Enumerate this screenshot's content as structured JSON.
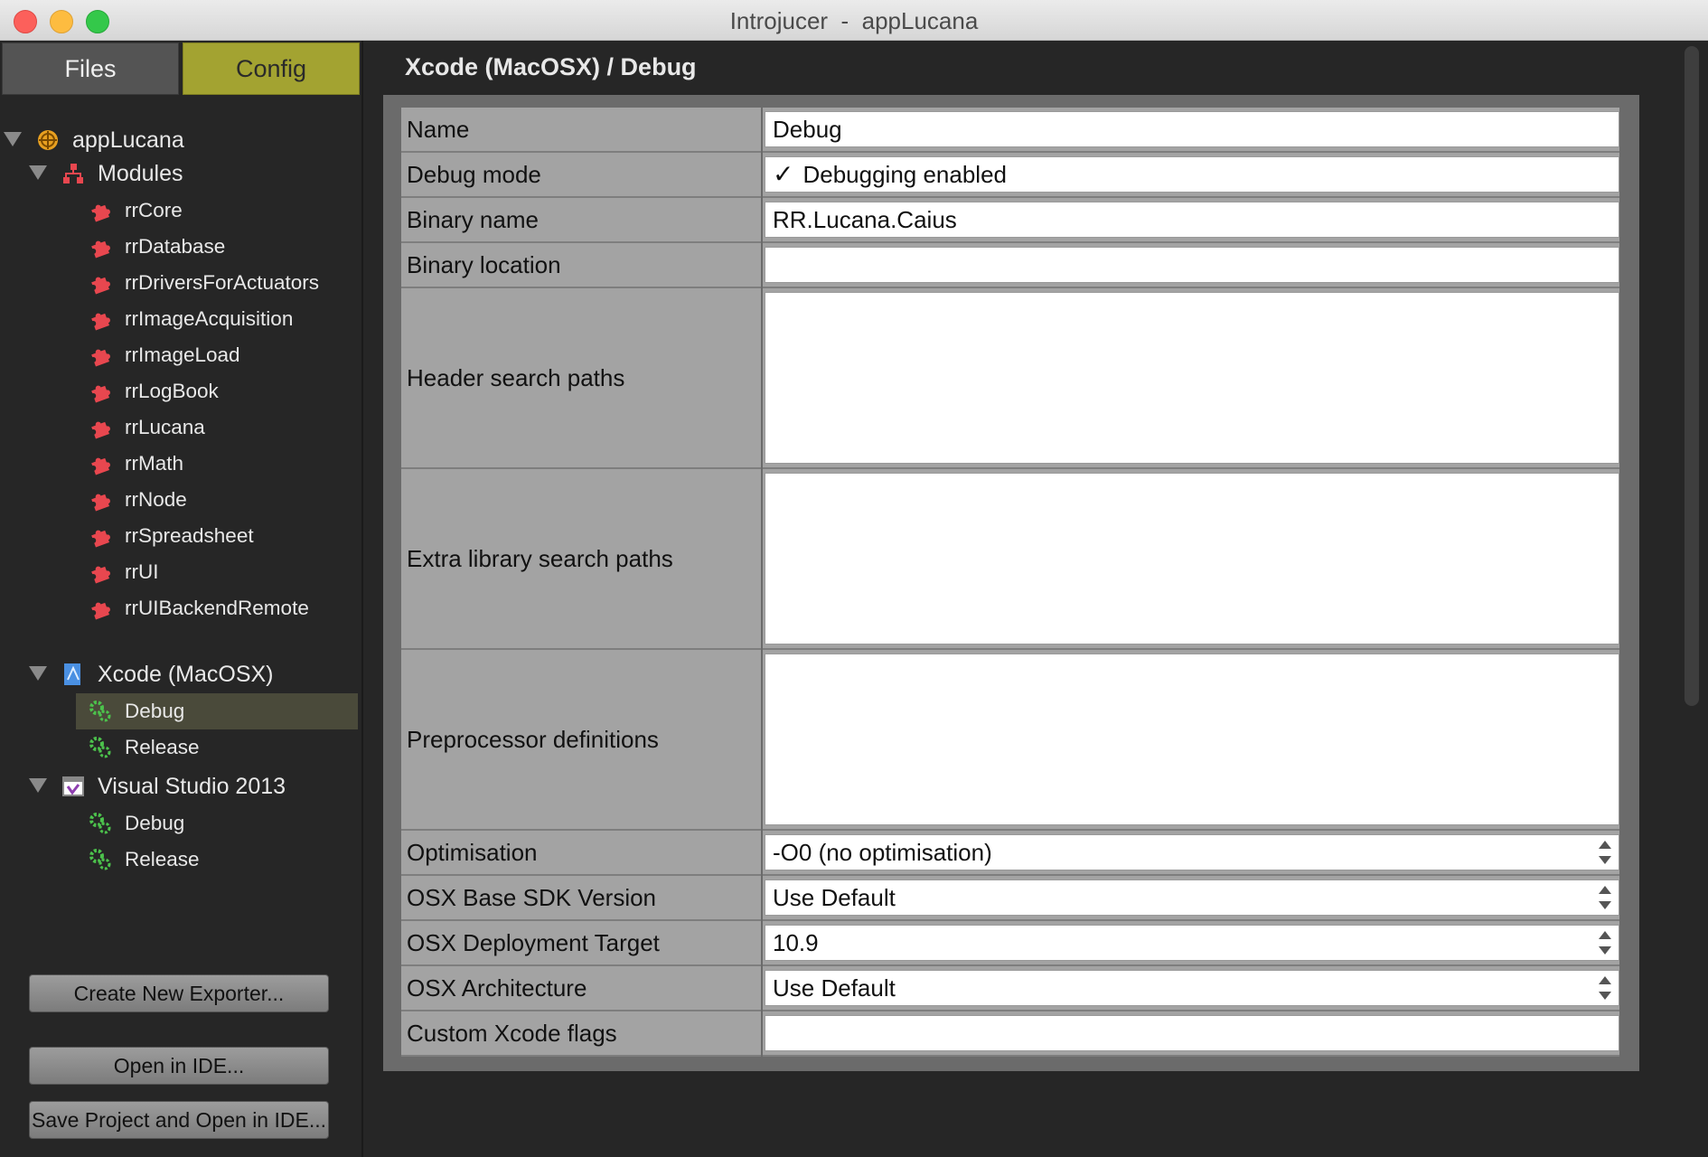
{
  "window": {
    "title": "Introjucer  -  appLucana"
  },
  "sidebar": {
    "tabs": {
      "files": "Files",
      "config": "Config"
    },
    "tree": {
      "project": "appLucana",
      "modules_label": "Modules",
      "modules": [
        "rrCore",
        "rrDatabase",
        "rrDriversForActuators",
        "rrImageAcquisition",
        "rrImageLoad",
        "rrLogBook",
        "rrLucana",
        "rrMath",
        "rrNode",
        "rrSpreadsheet",
        "rrUI",
        "rrUIBackendRemote"
      ],
      "exporters": [
        {
          "name": "Xcode (MacOSX)",
          "configs": [
            "Debug",
            "Release"
          ]
        },
        {
          "name": "Visual Studio 2013",
          "configs": [
            "Debug",
            "Release"
          ]
        }
      ]
    },
    "buttons": {
      "create_exporter": "Create New Exporter...",
      "open_ide": "Open in IDE...",
      "save_open_ide": "Save Project and Open in IDE..."
    }
  },
  "main": {
    "breadcrumb": "Xcode (MacOSX) / Debug",
    "fields": {
      "name": {
        "label": "Name",
        "value": "Debug"
      },
      "debug_mode": {
        "label": "Debug mode",
        "value": "Debugging enabled",
        "checked": true
      },
      "binary_name": {
        "label": "Binary name",
        "value": "RR.Lucana.Caius"
      },
      "binary_location": {
        "label": "Binary location",
        "value": ""
      },
      "header_search": {
        "label": "Header search paths",
        "value": ""
      },
      "extra_lib_search": {
        "label": "Extra library search paths",
        "value": ""
      },
      "preprocessor": {
        "label": "Preprocessor definitions",
        "value": ""
      },
      "optimisation": {
        "label": "Optimisation",
        "value": "-O0 (no optimisation)"
      },
      "osx_sdk": {
        "label": "OSX Base SDK Version",
        "value": "Use Default"
      },
      "osx_target": {
        "label": "OSX Deployment Target",
        "value": "10.9"
      },
      "osx_arch": {
        "label": "OSX Architecture",
        "value": "Use Default"
      },
      "custom_xcode": {
        "label": "Custom Xcode flags",
        "value": ""
      }
    }
  },
  "colors": {
    "config_tab": "#a3a331",
    "module_icon": "#e8474f",
    "config_icon": "#4cc24c"
  }
}
